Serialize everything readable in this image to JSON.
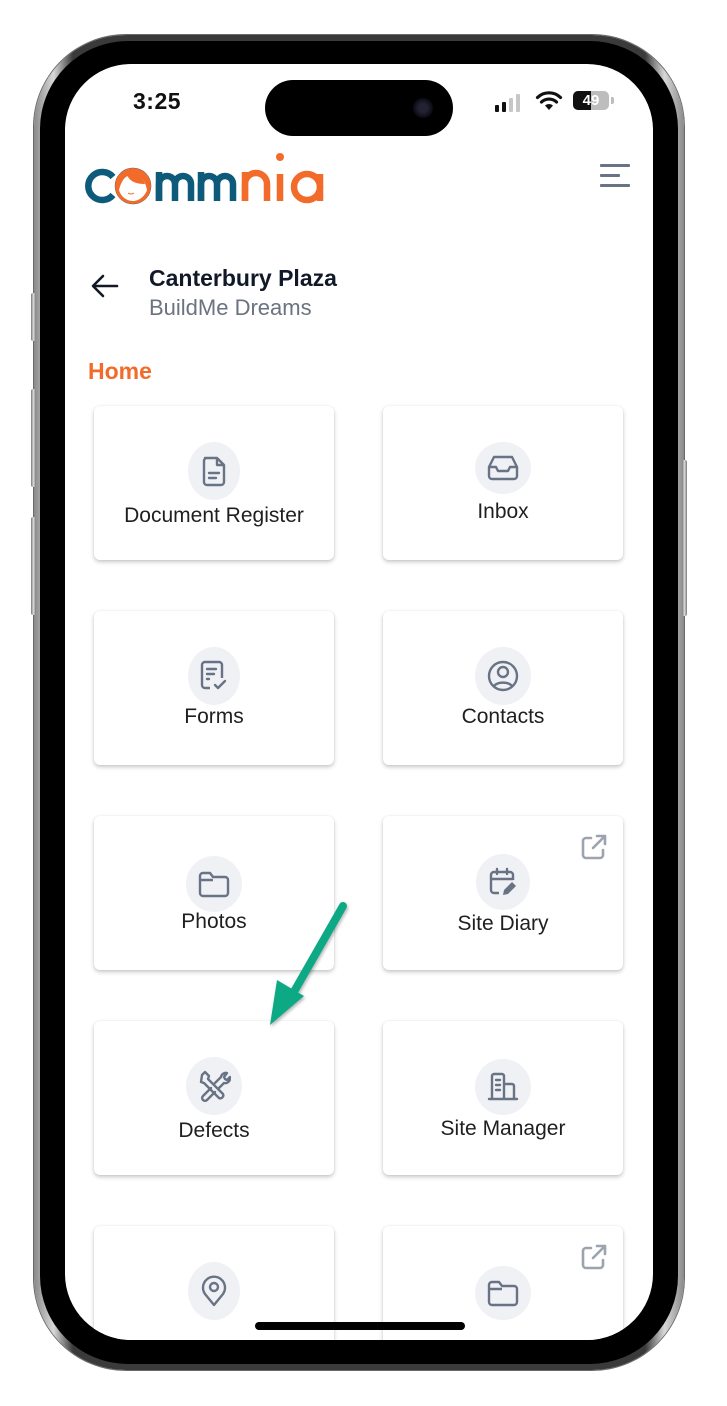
{
  "status_bar": {
    "time": "3:25",
    "battery_percent": "49",
    "signal_bars_active": 2,
    "signal_bars_total": 4
  },
  "header": {
    "logo_text_dark": "comm",
    "logo_text_orange": "nia",
    "logo_colors": {
      "dark": "#0d5a7a",
      "orange": "#f26b2a"
    },
    "menu_icon": "hamburger-menu-icon"
  },
  "project": {
    "title": "Canterbury Plaza",
    "subtitle": "BuildMe Dreams",
    "back_icon": "arrow-left-icon"
  },
  "section": {
    "label": "Home",
    "accent_color": "#f26b2a"
  },
  "tiles": [
    {
      "label": "Document Register",
      "icon": "document-icon",
      "external": false
    },
    {
      "label": "Inbox",
      "icon": "inbox-tray-icon",
      "external": false
    },
    {
      "label": "Forms",
      "icon": "form-check-icon",
      "external": false
    },
    {
      "label": "Contacts",
      "icon": "user-circle-icon",
      "external": false
    },
    {
      "label": "Photos",
      "icon": "folder-icon",
      "external": false
    },
    {
      "label": "Site Diary",
      "icon": "calendar-edit-icon",
      "external": true
    },
    {
      "label": "Defects",
      "icon": "tools-icon",
      "external": false
    },
    {
      "label": "Site Manager",
      "icon": "building-icon",
      "external": false
    },
    {
      "label": "",
      "icon": "map-pin-icon",
      "external": false
    },
    {
      "label": "",
      "icon": "folder-icon",
      "external": true
    }
  ],
  "annotation": {
    "arrow_color": "#10a884",
    "points_to": "Defects"
  }
}
